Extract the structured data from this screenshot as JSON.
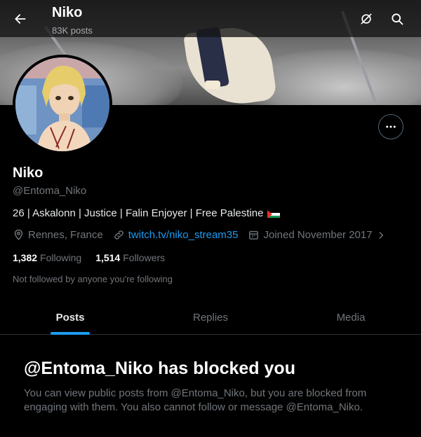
{
  "header": {
    "title": "Niko",
    "post_count": "83K posts"
  },
  "profile": {
    "name": "Niko",
    "handle": "@Entoma_Niko",
    "bio": "26 | Askalonn | Justice | Falin Enjoyer | Free Palestine",
    "location": "Rennes, France",
    "website": "twitch.tv/niko_stream35",
    "joined": "Joined November 2017",
    "following_count": "1,382",
    "following_label": "Following",
    "followers_count": "1,514",
    "followers_label": "Followers",
    "not_followed_text": "Not followed by anyone you're following"
  },
  "tabs": [
    {
      "label": "Posts",
      "active": true
    },
    {
      "label": "Replies",
      "active": false
    },
    {
      "label": "Media",
      "active": false
    }
  ],
  "blocked": {
    "title": "@Entoma_Niko has blocked you",
    "description": "You can view public posts from @Entoma_Niko, but you are blocked from engaging with them. You also cannot follow or message @Entoma_Niko."
  },
  "colors": {
    "accent": "#1d9bf0",
    "background": "#000000",
    "muted_text": "#71767b"
  }
}
